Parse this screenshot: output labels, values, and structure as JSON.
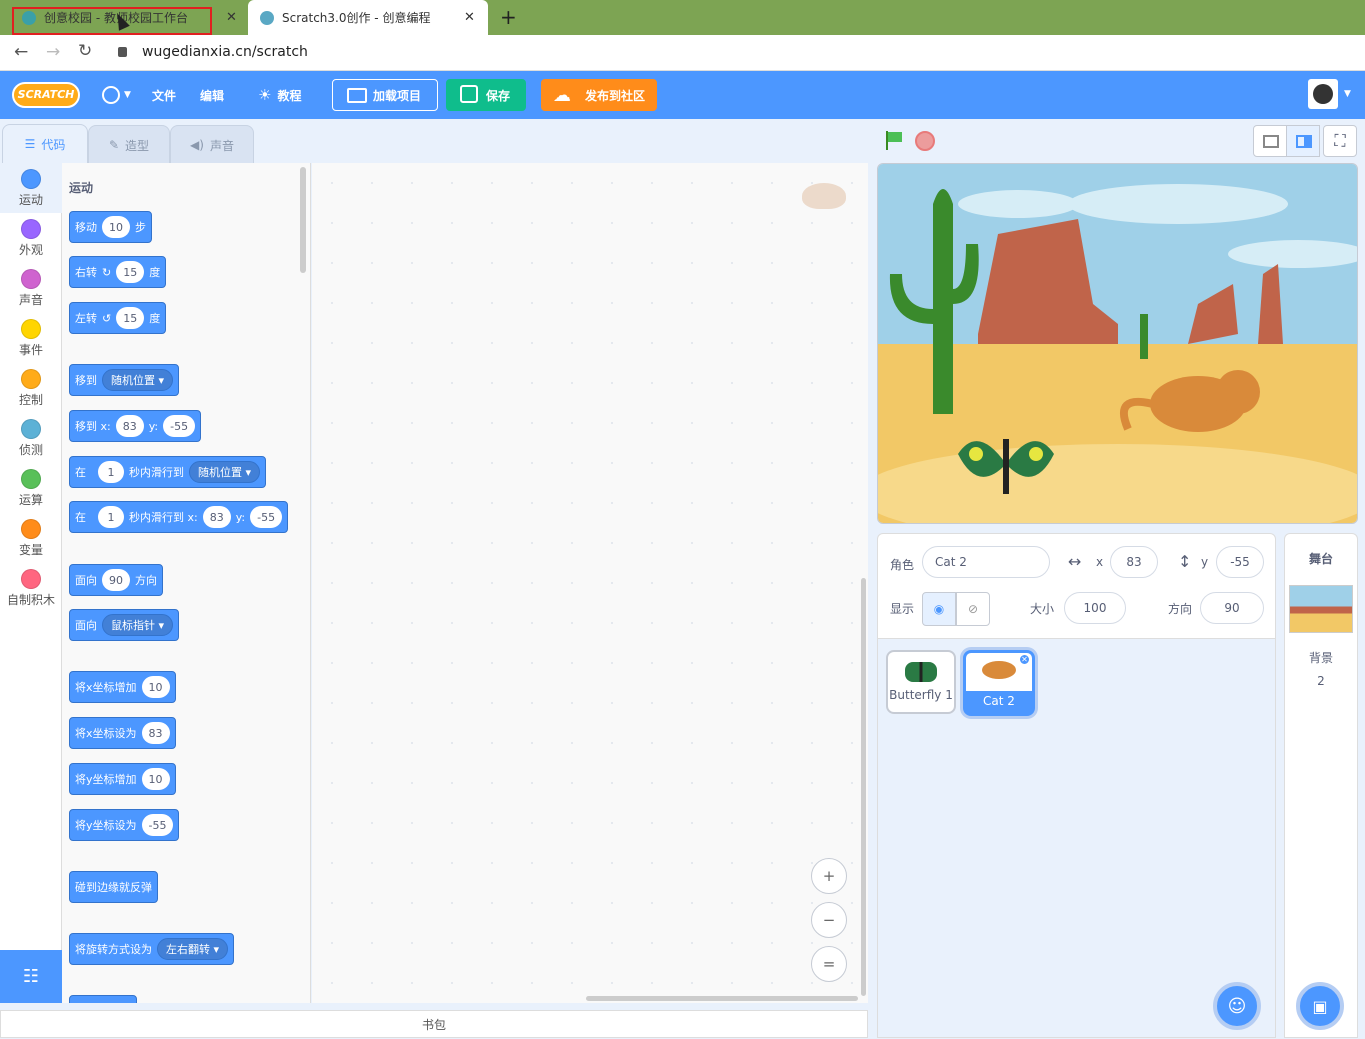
{
  "browser": {
    "tabs": [
      {
        "title": "创意校园 - 教师校园工作台",
        "close": "✕"
      },
      {
        "title": "Scratch3.0创作 - 创意编程",
        "close": "✕"
      }
    ],
    "new_tab": "+",
    "url": "wugedianxia.cn/scratch"
  },
  "menubar": {
    "logo": "SCRATCH",
    "file": "文件",
    "edit": "编辑",
    "tutorial": "教程",
    "load_project": "加载项目",
    "save": "保存",
    "publish": "发布到社区"
  },
  "editor_tabs": {
    "code": "代码",
    "costumes": "造型",
    "sounds": "声音"
  },
  "categories": [
    {
      "label": "运动",
      "color": "#4c97ff"
    },
    {
      "label": "外观",
      "color": "#9966ff"
    },
    {
      "label": "声音",
      "color": "#cf63cf"
    },
    {
      "label": "事件",
      "color": "#ffd500"
    },
    {
      "label": "控制",
      "color": "#ffab19"
    },
    {
      "label": "侦测",
      "color": "#5cb1d6"
    },
    {
      "label": "运算",
      "color": "#59c059"
    },
    {
      "label": "变量",
      "color": "#ff8c1a"
    },
    {
      "label": "自制积木",
      "color": "#ff6680"
    }
  ],
  "palette": {
    "section_title": "运动",
    "blocks": {
      "move": {
        "a": "移动",
        "v": "10",
        "b": "步"
      },
      "turn_right": {
        "a": "右转",
        "v": "15",
        "b": "度"
      },
      "turn_left": {
        "a": "左转",
        "v": "15",
        "b": "度"
      },
      "goto": {
        "a": "移到",
        "dd": "随机位置"
      },
      "goto_xy": {
        "a": "移到 x:",
        "x": "83",
        "b": "y:",
        "y": "-55"
      },
      "glide": {
        "a": "在",
        "v": "1",
        "b": "秒内滑行到",
        "dd": "随机位置"
      },
      "glide_xy": {
        "a": "在",
        "v": "1",
        "b": "秒内滑行到 x:",
        "x": "83",
        "c": "y:",
        "y": "-55"
      },
      "point_dir": {
        "a": "面向",
        "v": "90",
        "b": "方向"
      },
      "point_towards": {
        "a": "面向",
        "dd": "鼠标指针"
      },
      "change_x": {
        "a": "将x坐标增加",
        "v": "10"
      },
      "set_x": {
        "a": "将x坐标设为",
        "v": "83"
      },
      "change_y": {
        "a": "将y坐标增加",
        "v": "10"
      },
      "set_y": {
        "a": "将y坐标设为",
        "v": "-55"
      },
      "bounce": {
        "a": "碰到边缘就反弹"
      },
      "rotation": {
        "a": "将旋转方式设为",
        "dd": "左右翻转"
      }
    }
  },
  "zoom": {
    "in": "+",
    "out": "−",
    "reset": "="
  },
  "backpack": "书包",
  "sprite_info": {
    "sprite_label": "角色",
    "sprite_name": "Cat 2",
    "x_label": "x",
    "x": "83",
    "y_label": "y",
    "y": "-55",
    "show_label": "显示",
    "size_label": "大小",
    "size": "100",
    "direction_label": "方向",
    "direction": "90"
  },
  "sprites": [
    {
      "name": "Butterfly 1"
    },
    {
      "name": "Cat 2"
    }
  ],
  "stage_panel": {
    "title": "舞台",
    "backdrop_label": "背景",
    "backdrop_count": "2"
  }
}
